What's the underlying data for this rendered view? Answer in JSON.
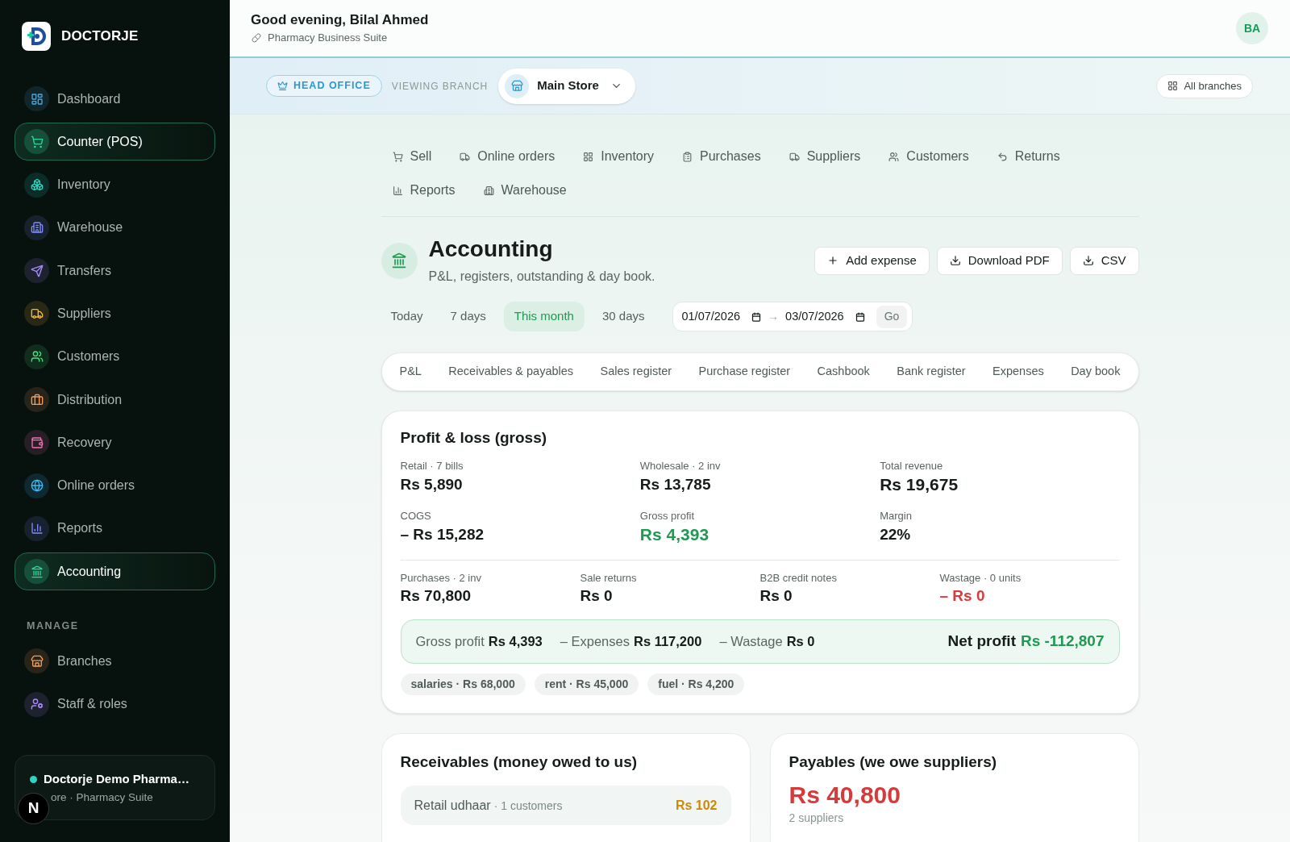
{
  "sidebar": {
    "brand": "DOCTORJE",
    "items": [
      {
        "label": "Dashboard",
        "color": "#4ea8de",
        "selected": false
      },
      {
        "label": "Counter (POS)",
        "color": "#34d399",
        "selected": true
      },
      {
        "label": "Inventory",
        "color": "#2dd4bf",
        "selected": false
      },
      {
        "label": "Warehouse",
        "color": "#818cf8",
        "selected": false
      },
      {
        "label": "Transfers",
        "color": "#a78bfa",
        "selected": false
      },
      {
        "label": "Suppliers",
        "color": "#f5b841",
        "selected": false
      },
      {
        "label": "Customers",
        "color": "#4ade80",
        "selected": false
      },
      {
        "label": "Distribution",
        "color": "#f59e5b",
        "selected": false
      },
      {
        "label": "Recovery",
        "color": "#f472b6",
        "selected": false
      },
      {
        "label": "Online orders",
        "color": "#38bdf8",
        "selected": false
      },
      {
        "label": "Reports",
        "color": "#818cf8",
        "selected": false
      },
      {
        "label": "Accounting",
        "color": "#34d399",
        "selected": true
      }
    ],
    "manage_label": "MANAGE",
    "manage_items": [
      {
        "label": "Branches",
        "color": "#f59e5b",
        "selected": false
      },
      {
        "label": "Staff & roles",
        "color": "#a78bfa",
        "selected": false
      }
    ],
    "org": {
      "name": "Doctorje Demo Pharma…",
      "subtitle": "ore · Pharmacy Suite"
    }
  },
  "dev_badge": "N",
  "header": {
    "greeting": "Good evening, Bilal Ahmed",
    "subtitle": "Pharmacy Business Suite",
    "avatar": "BA"
  },
  "branch_bar": {
    "role_badge": "HEAD OFFICE",
    "viewing_label": "VIEWING BRANCH",
    "branch": "Main Store",
    "all_branches": "All branches"
  },
  "nav_tabs": [
    "Sell",
    "Online orders",
    "Inventory",
    "Purchases",
    "Suppliers",
    "Customers",
    "Returns",
    "Reports",
    "Warehouse"
  ],
  "page": {
    "title": "Accounting",
    "subtitle": "P&L, registers, outstanding & day book.",
    "actions": [
      "Add expense",
      "Download PDF",
      "CSV"
    ]
  },
  "period_filter": {
    "options": [
      {
        "label": "Today",
        "selected": false
      },
      {
        "label": "7 days",
        "selected": false
      },
      {
        "label": "This month",
        "selected": true
      },
      {
        "label": "30 days",
        "selected": false
      }
    ],
    "date_from": "01/07/2026",
    "arrow": "→",
    "date_to": "03/07/2026",
    "go": "Go"
  },
  "section_tabs": [
    "P&L",
    "Receivables & payables",
    "Sales register",
    "Purchase register",
    "Cashbook",
    "Bank register",
    "Expenses",
    "Day book"
  ],
  "pnl_card": {
    "title": "Profit & loss (gross)",
    "metrics": [
      {
        "label": "Retail · 7 bills",
        "value": "Rs 5,890",
        "kind": "plain"
      },
      {
        "label": "Wholesale · 2 inv",
        "value": "Rs 13,785",
        "kind": "plain"
      },
      {
        "label": "Total revenue",
        "value": "Rs 19,675",
        "kind": "large"
      },
      {
        "label": "COGS",
        "value": "– Rs 15,282",
        "kind": "plain"
      },
      {
        "label": "Gross profit",
        "value": "Rs 4,393",
        "kind": "positive"
      },
      {
        "label": "Margin",
        "value": "22%",
        "kind": "plain"
      }
    ],
    "totals": [
      {
        "label": "Purchases · 2 inv",
        "value": "Rs 70,800",
        "kind": "plain"
      },
      {
        "label": "Sale returns",
        "value": "Rs 0",
        "kind": "plain"
      },
      {
        "label": "B2B credit notes",
        "value": "Rs 0",
        "kind": "plain"
      },
      {
        "label": "Wastage · 0 units",
        "value": "– Rs 0",
        "kind": "negative"
      }
    ],
    "net_summary": {
      "parts": [
        {
          "label": "Gross profit",
          "value": "Rs 4,393"
        },
        {
          "label": "– Expenses",
          "value": "Rs 117,200"
        },
        {
          "label": "– Wastage",
          "value": "Rs 0"
        }
      ],
      "net_label": "Net profit",
      "net_value": "Rs -112,807"
    },
    "expense_tags": [
      "salaries · Rs 68,000",
      "rent · Rs 45,000",
      "fuel · Rs 4,200"
    ]
  },
  "receivables": {
    "title": "Receivables (money owed to us)",
    "rows": [
      {
        "label": "Retail udhaar",
        "detail": "· 1 customers",
        "amount": "Rs 102"
      }
    ]
  },
  "payables": {
    "title": "Payables (we owe suppliers)",
    "amount": "Rs 40,800",
    "detail": "2 suppliers"
  }
}
